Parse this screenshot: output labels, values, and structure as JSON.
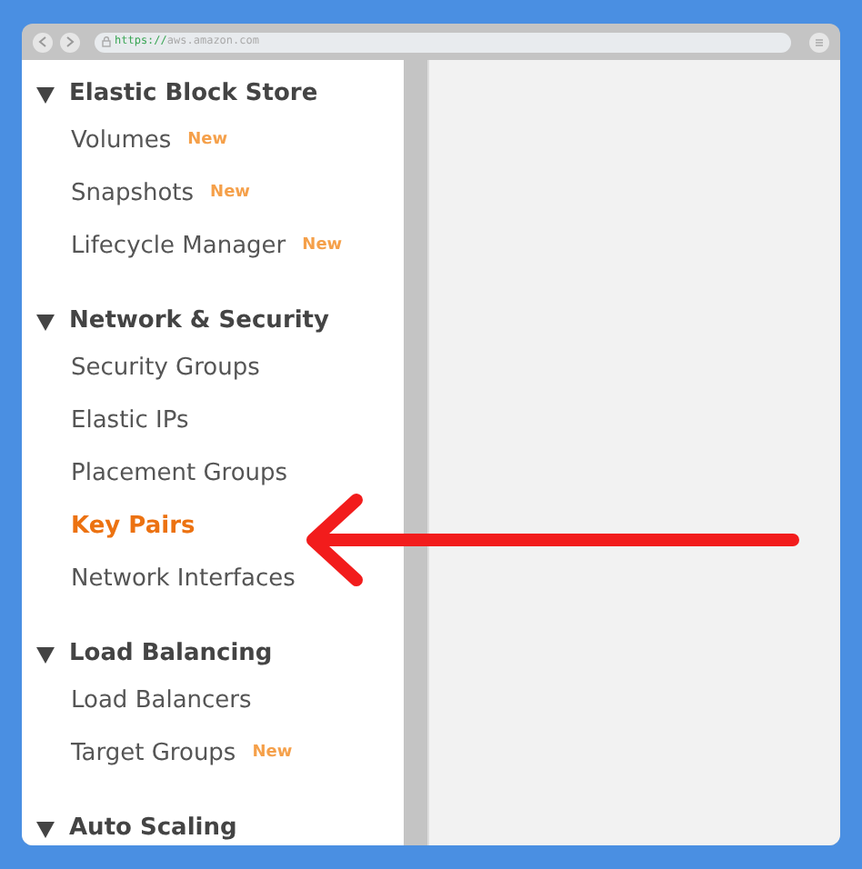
{
  "browser": {
    "url_scheme": "https://",
    "url_host": "aws.amazon.com"
  },
  "sidebar": {
    "sections": [
      {
        "title": "Elastic Block Store",
        "expanded": true,
        "items": [
          {
            "label": "Volumes",
            "badge": "New",
            "selected": false
          },
          {
            "label": "Snapshots",
            "badge": "New",
            "selected": false
          },
          {
            "label": "Lifecycle Manager",
            "badge": "New",
            "selected": false
          }
        ]
      },
      {
        "title": "Network & Security",
        "expanded": true,
        "items": [
          {
            "label": "Security Groups",
            "selected": false
          },
          {
            "label": "Elastic IPs",
            "selected": false
          },
          {
            "label": "Placement Groups",
            "selected": false
          },
          {
            "label": "Key Pairs",
            "selected": true
          },
          {
            "label": "Network Interfaces",
            "selected": false
          }
        ]
      },
      {
        "title": "Load Balancing",
        "expanded": true,
        "items": [
          {
            "label": "Load Balancers",
            "selected": false
          },
          {
            "label": "Target Groups",
            "badge": "New",
            "selected": false
          }
        ]
      },
      {
        "title": "Auto Scaling",
        "expanded": true
      }
    ]
  }
}
